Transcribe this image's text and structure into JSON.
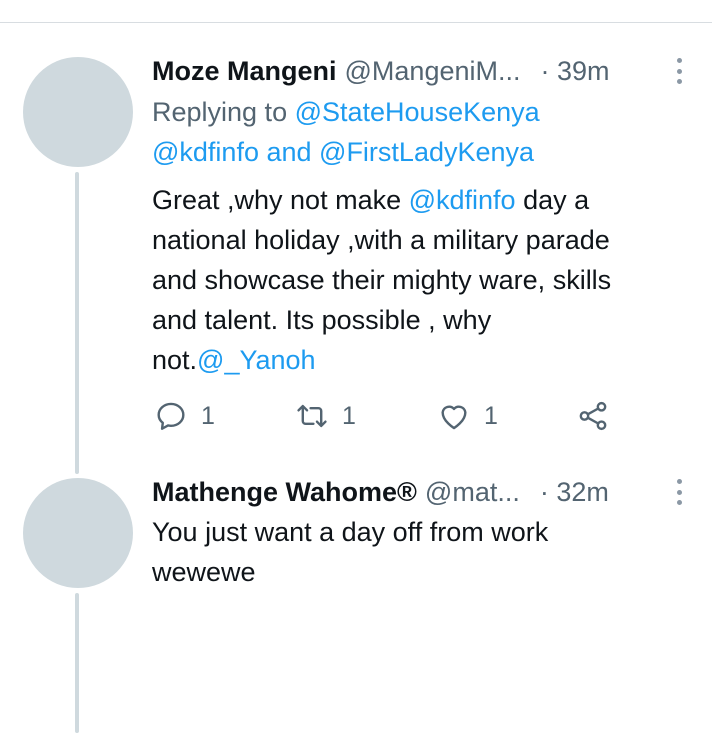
{
  "tweets": [
    {
      "name": "Moze Mangeni",
      "handle": "@MangeniM...",
      "time": "· 39m",
      "reply": {
        "prefix": "Replying to ",
        "mention1": "@StateHouseKenya",
        "mention2": "@kdfinfo",
        "joiner": " and ",
        "mention3": "@FirstLadyKenya"
      },
      "body": {
        "l1_a": "Great ,why not make ",
        "l1_m": "@kdfinfo",
        "l1_b": " day a",
        "l2": "national holiday ,with a military parade",
        "l3": "and showcase their mighty ware, skills",
        "l4": "and talent. Its possible , why",
        "l5_a": "not.",
        "l5_m": "@_Yanoh"
      },
      "actions": {
        "replies": "1",
        "retweets": "1",
        "likes": "1"
      }
    },
    {
      "name": "Mathenge Wahome®",
      "handle": "@mat...",
      "time": "· 32m",
      "body": {
        "l1": "You just want a day off from work",
        "l2": "wewewe"
      }
    }
  ],
  "icons": {
    "reply": "comment-icon",
    "retweet": "retweet-icon",
    "like": "heart-icon",
    "share": "share-icon",
    "more": "more-icon"
  },
  "colors": {
    "link": "#1d9bf0",
    "secondary_text": "#536471",
    "avatar_placeholder": "#cfd9de"
  }
}
